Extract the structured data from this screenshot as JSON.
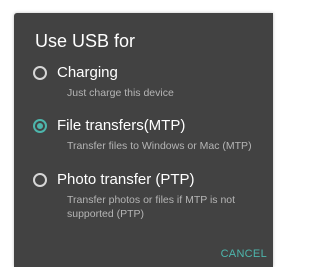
{
  "dialog": {
    "title": "Use USB for",
    "accent_color": "#4db6ac",
    "background_color": "#424242",
    "options": [
      {
        "label": "Charging",
        "description": "Just charge this device",
        "selected": false
      },
      {
        "label": "File transfers(MTP)",
        "description": "Transfer files to Windows or Mac (MTP)",
        "selected": true
      },
      {
        "label": "Photo transfer (PTP)",
        "description": "Transfer photos or files if MTP is not supported (PTP)",
        "selected": false
      }
    ],
    "cancel_label": "CANCEL"
  }
}
